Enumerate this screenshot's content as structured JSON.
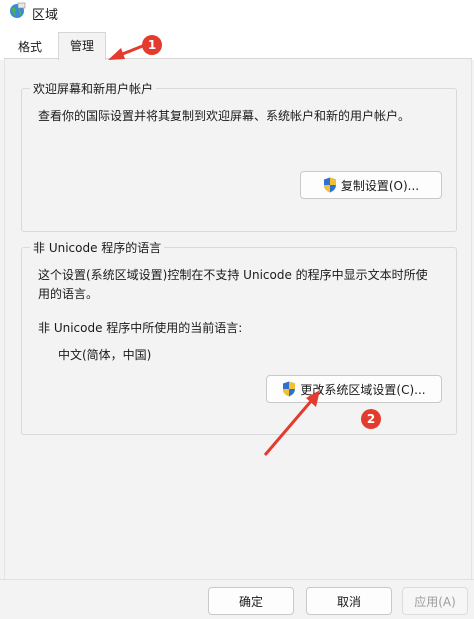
{
  "window": {
    "title": "区域",
    "icon": "globe-region-icon"
  },
  "tabs": [
    {
      "label": "格式",
      "selected": false
    },
    {
      "label": "管理",
      "selected": true
    }
  ],
  "welcome_group": {
    "title": "欢迎屏幕和新用户帐户",
    "description": "查看你的国际设置并将其复制到欢迎屏幕、系统帐户和新的用户帐户。",
    "copy_button": "复制设置(O)..."
  },
  "unicode_group": {
    "title": "非 Unicode 程序的语言",
    "description_line1": "这个设置(系统区域设置)控制在不支持 Unicode 的程序中显示文本时所使",
    "description_line2": "用的语言。",
    "current_label": "非 Unicode 程序中所使用的当前语言:",
    "current_value": "中文(简体，中国)",
    "change_button": "更改系统区域设置(C)..."
  },
  "footer": {
    "ok": "确定",
    "cancel": "取消",
    "apply": "应用(A)"
  },
  "annotations": [
    {
      "number": "1"
    },
    {
      "number": "2"
    }
  ],
  "colors": {
    "annotation": "#e43b2f",
    "shield_blue": "#2f6fd3",
    "shield_yellow": "#f2c12e"
  }
}
